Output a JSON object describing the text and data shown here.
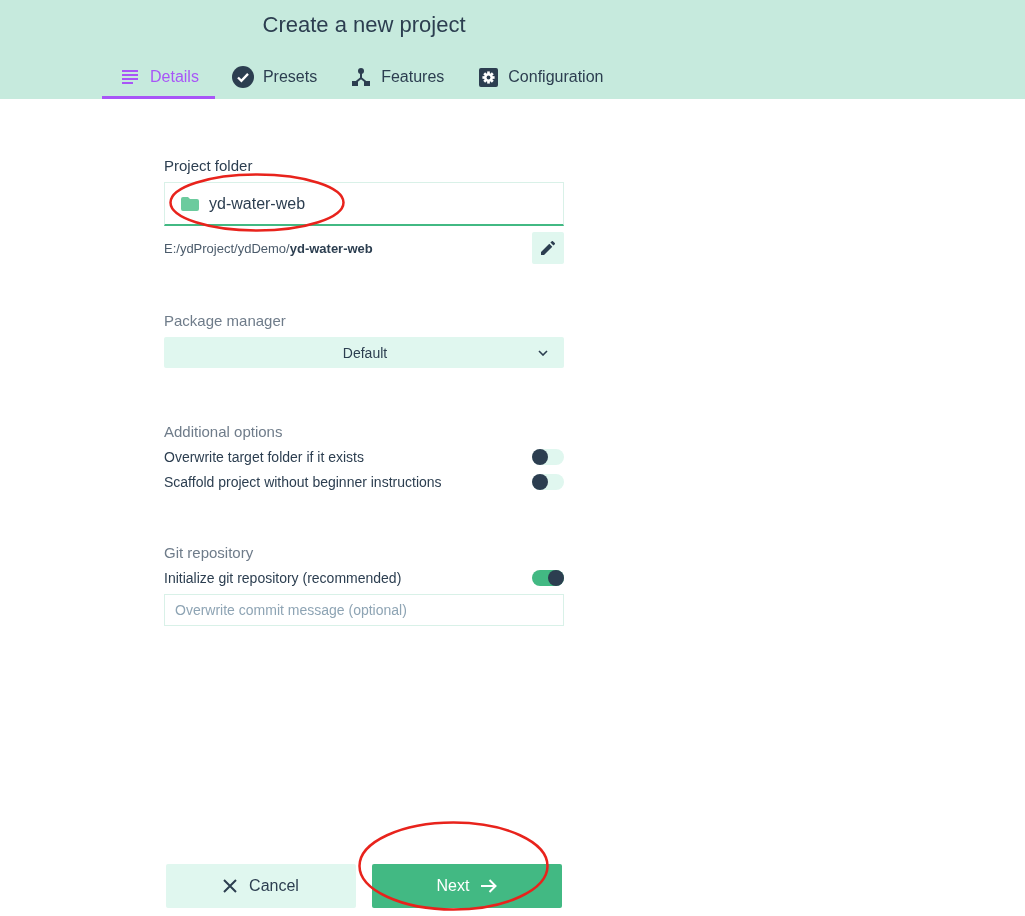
{
  "header": {
    "title": "Create a new project"
  },
  "tabs": [
    {
      "label": "Details",
      "kind": "list",
      "selected": true
    },
    {
      "label": "Presets",
      "kind": "check",
      "selected": false
    },
    {
      "label": "Features",
      "kind": "branch",
      "selected": false
    },
    {
      "label": "Configuration",
      "kind": "gear",
      "selected": false
    }
  ],
  "project_folder": {
    "label": "Project folder",
    "value": "yd-water-web",
    "path": "E:/ydProject/ydDemo/**yd-water-web**",
    "circled": true
  },
  "package_manager": {
    "label": "Package manager",
    "value": "Default"
  },
  "additional_options": {
    "label": "Additional options",
    "toggles": [
      {
        "label": "Overwrite target folder if it exists",
        "on": false
      },
      {
        "label": "Scaffold project without beginner instructions",
        "on": false
      }
    ]
  },
  "git_repository": {
    "label": "Git repository",
    "toggles": [
      {
        "label": "Initialize git repository (recommended)",
        "on": true
      }
    ],
    "commit_message": {
      "placeholder": "Overwrite commit message (optional)"
    }
  },
  "buttons": [
    {
      "kind": "cancel",
      "label": "Cancel",
      "circled": false
    },
    {
      "kind": "next",
      "label": "Next",
      "circled": true
    }
  ]
}
